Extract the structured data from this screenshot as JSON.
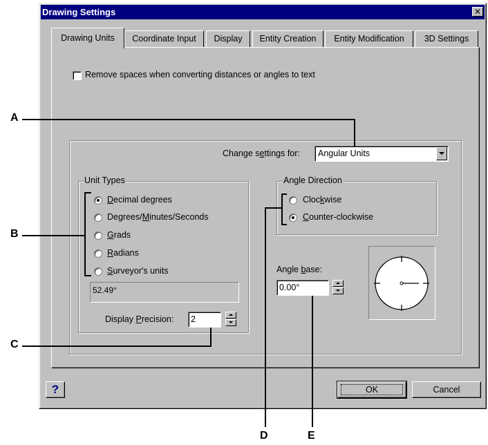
{
  "window": {
    "title": "Drawing Settings",
    "close_glyph": "✕"
  },
  "tabs": [
    {
      "label": "Drawing Units",
      "active": true
    },
    {
      "label": "Coordinate Input"
    },
    {
      "label": "Display"
    },
    {
      "label": "Entity Creation"
    },
    {
      "label": "Entity Modification"
    },
    {
      "label": "3D Settings"
    }
  ],
  "remove_spaces": {
    "label": "Remove spaces when converting distances or angles to text",
    "checked": false
  },
  "change_settings": {
    "label_pre": "Change s",
    "label_u": "e",
    "label_post": "ttings for:",
    "value": "Angular Units"
  },
  "unit_types": {
    "title": "Unit Types",
    "options": [
      {
        "u": "D",
        "rest": "ecimal degrees",
        "selected": true
      },
      {
        "pre": "Degrees/",
        "u": "M",
        "rest": "inutes/Seconds",
        "selected": false
      },
      {
        "u": "G",
        "rest": "rads",
        "selected": false
      },
      {
        "u": "R",
        "rest": "adians",
        "selected": false
      },
      {
        "u": "S",
        "rest": "urveyor's units",
        "selected": false
      }
    ],
    "sample": "52.49°",
    "precision_label_pre": "Display ",
    "precision_label_u": "P",
    "precision_label_post": "recision:",
    "precision_value": "2"
  },
  "angle_direction": {
    "title": "Angle Direction",
    "options": [
      {
        "pre": "Cloc",
        "u": "k",
        "rest": "wise",
        "selected": false
      },
      {
        "u": "C",
        "rest": "ounter-clockwise",
        "selected": true
      }
    ]
  },
  "angle_base": {
    "label_pre": "Angle ",
    "label_u": "b",
    "label_post": "ase:",
    "value": "0.00°"
  },
  "buttons": {
    "ok": "OK",
    "cancel": "Cancel",
    "help": "?"
  },
  "callouts": [
    "A",
    "B",
    "C",
    "D",
    "E"
  ]
}
